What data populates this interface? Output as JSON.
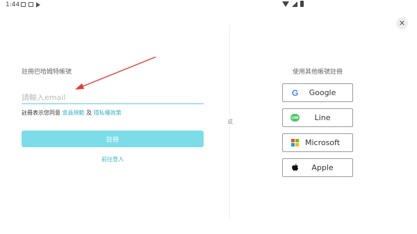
{
  "statusbar": {
    "time": "1:44"
  },
  "close": {
    "symbol": "✕"
  },
  "signup": {
    "heading": "註冊巴哈姆特帳號",
    "email_placeholder": "請輸入email",
    "terms_prefix": "註冊表示您同意",
    "terms_link": "會員規範",
    "terms_and": "及",
    "privacy_link": "隱私權政策",
    "register_label": "註冊",
    "goto_login": "前往登入"
  },
  "divider": {
    "or": "或"
  },
  "social": {
    "heading": "使用其他帳號註冊",
    "buttons": [
      {
        "label": "Google",
        "icon": "google-icon"
      },
      {
        "label": "Line",
        "icon": "line-icon"
      },
      {
        "label": "Microsoft",
        "icon": "microsoft-icon"
      },
      {
        "label": "Apple",
        "icon": "apple-icon"
      }
    ]
  },
  "colors": {
    "accent": "#5ecce0",
    "button": "#7cdde9",
    "link": "#35b2c6",
    "annotation_arrow": "#e53935"
  }
}
